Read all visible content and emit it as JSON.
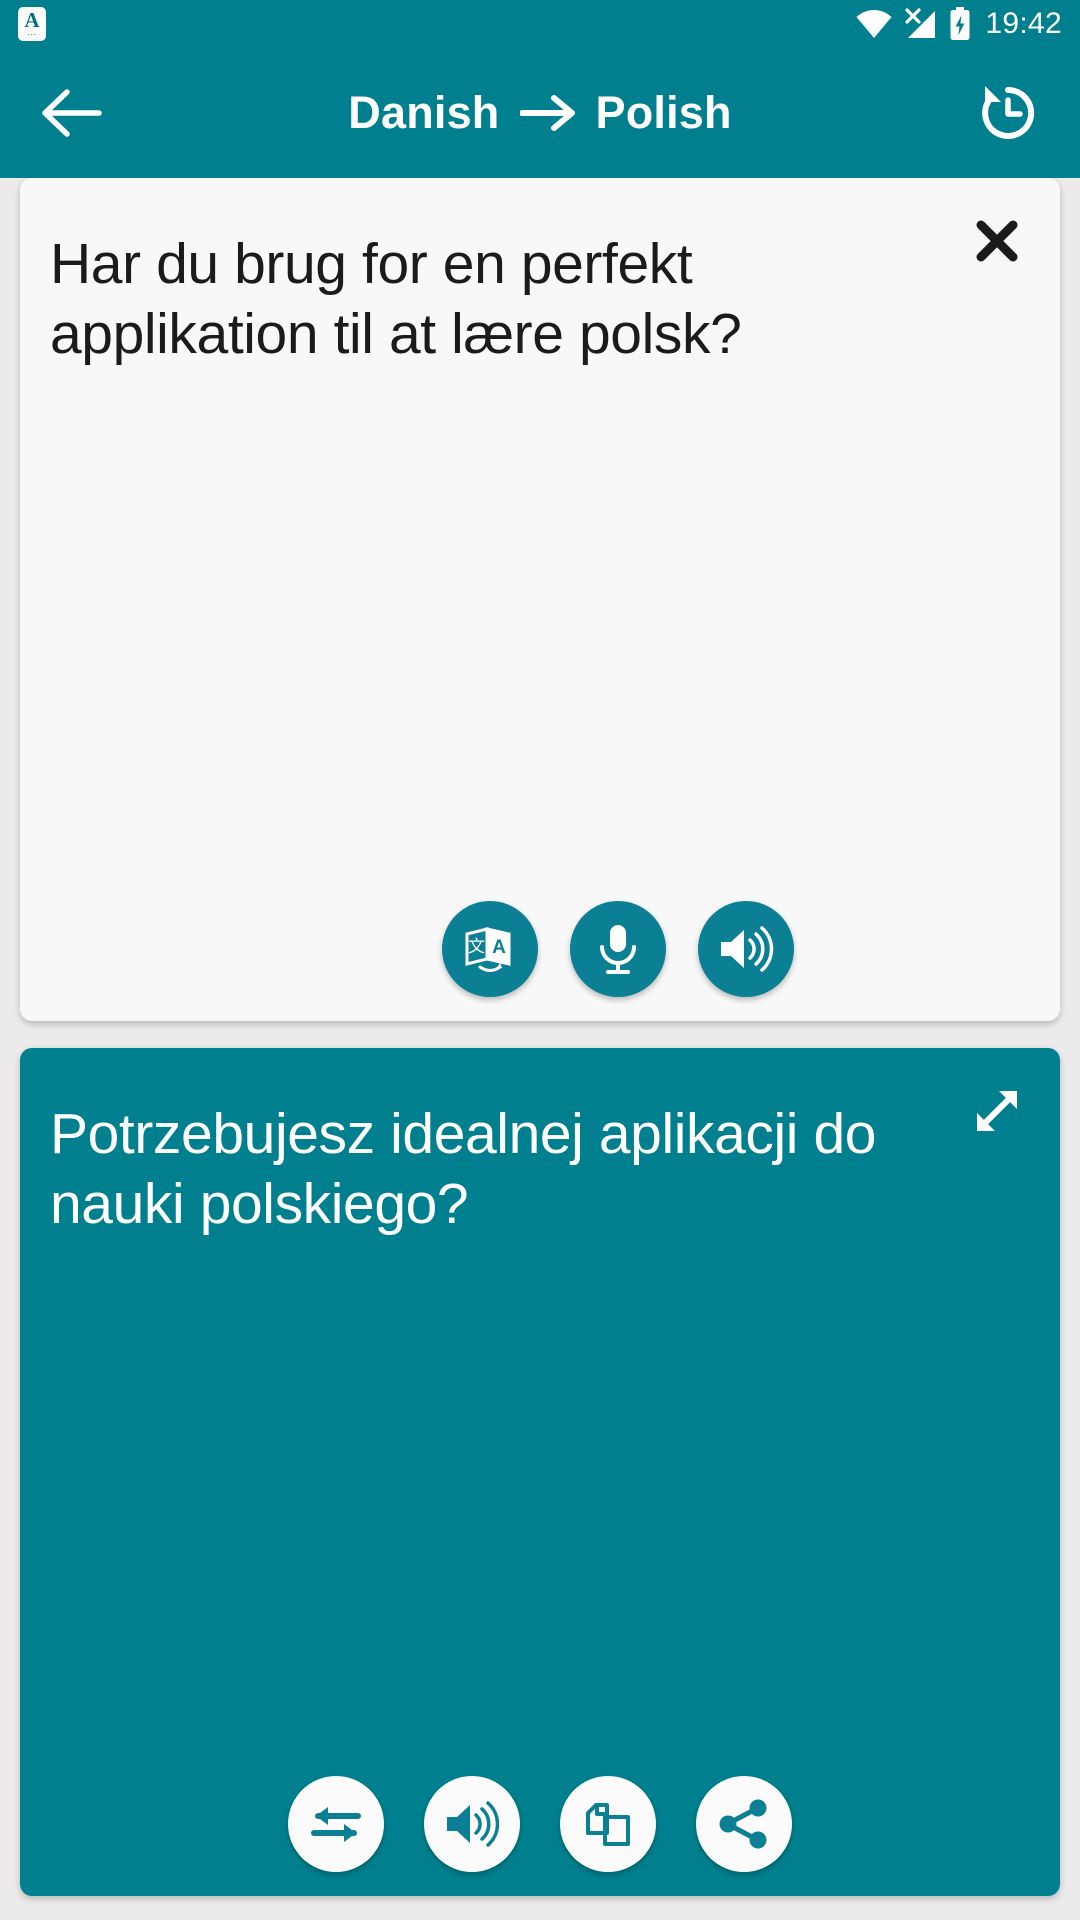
{
  "status_bar": {
    "time": "19:42",
    "notification_icon": {
      "name": "app-notification-icon",
      "letter": "A",
      "dots": "..."
    },
    "icons": [
      "wifi-icon",
      "cellular-no-sim-icon",
      "battery-charging-icon"
    ]
  },
  "app_bar": {
    "back_icon": "arrow-left-icon",
    "source_language": "Danish",
    "arrow": "→",
    "target_language": "Polish",
    "title": "Danish → Polish",
    "history_icon": "history-icon"
  },
  "source_card": {
    "text": "Har du brug for en perfekt applikation til at lære polsk?",
    "close_label": "✕",
    "close_icon": "close-icon",
    "buttons": [
      {
        "name": "translate-button",
        "icon": "translate-icon"
      },
      {
        "name": "microphone-button",
        "icon": "microphone-icon"
      },
      {
        "name": "speak-source-button",
        "icon": "speaker-icon"
      }
    ]
  },
  "target_card": {
    "text": "Potrzebujesz idealnej aplikacji do nauki polskiego?",
    "expand_icon": "expand-fullscreen-icon",
    "buttons": [
      {
        "name": "swap-languages-button",
        "icon": "swap-arrows-icon"
      },
      {
        "name": "speak-translation-button",
        "icon": "speaker-icon"
      },
      {
        "name": "copy-button",
        "icon": "copy-icon"
      },
      {
        "name": "share-button",
        "icon": "share-icon"
      }
    ]
  },
  "colors": {
    "primary": "#00808f",
    "primary_dark": "#0b7f93",
    "page_background": "#eceaea",
    "card_background": "#f8f8f8",
    "text_dark": "#1b1b1b",
    "text_light": "#ffffff"
  }
}
